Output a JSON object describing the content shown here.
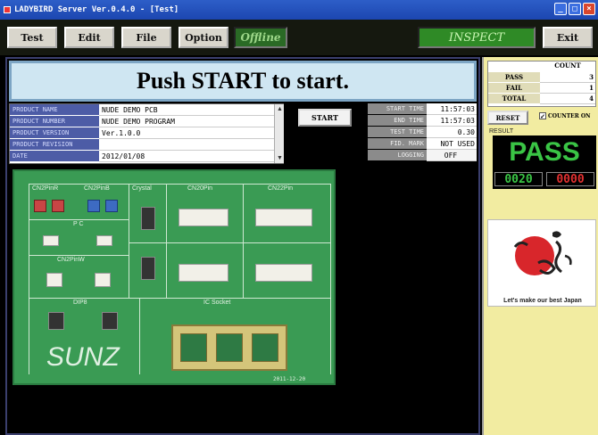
{
  "window": {
    "title": "LADYBIRD Server Ver.0.4.0 - [Test]"
  },
  "toolbar": {
    "test_label": "Test",
    "edit_label": "Edit",
    "file_label": "File",
    "option_label": "Option",
    "status_offline": "Offline",
    "mode_label": "INSPECT",
    "exit_label": "Exit"
  },
  "banner": {
    "text": "Push START to start."
  },
  "product": {
    "rows": [
      {
        "label": "PRODUCT NAME",
        "value": "NUDE DEMO PCB"
      },
      {
        "label": "PRODUCT NUMBER",
        "value": "NUDE DEMO PROGRAM"
      },
      {
        "label": "PRODUCT VERSION",
        "value": "Ver.1.0.0"
      },
      {
        "label": "PRODUCT REVISION",
        "value": ""
      },
      {
        "label": "DATE",
        "value": "2012/01/08"
      }
    ]
  },
  "start_button": "START",
  "times": {
    "rows": [
      {
        "label": "START TIME",
        "value": "11:57:03"
      },
      {
        "label": "END TIME",
        "value": "11:57:03"
      },
      {
        "label": "TEST TIME",
        "value": "0.30"
      },
      {
        "label": "FID. MARK",
        "value": "NOT USED"
      },
      {
        "label": "LOGGING",
        "value": "OFF"
      }
    ]
  },
  "pcb": {
    "labels": [
      "CN2PinR",
      "CN2PinB",
      "Crystal",
      "CN20Pin",
      "CN22Pin",
      "P C",
      "CN2PinW",
      "DIP8",
      "IC Socket"
    ],
    "brand": "SUNZ",
    "date": "2011-12-20"
  },
  "counter": {
    "header": "COUNT",
    "rows": [
      {
        "label": "PASS",
        "value": "3"
      },
      {
        "label": "FAIL",
        "value": "1"
      },
      {
        "label": "TOTAL",
        "value": "4"
      }
    ],
    "reset_label": "RESET",
    "counter_on_label": "COUNTER ON"
  },
  "result": {
    "label": "RESULT",
    "status": "PASS",
    "pass_count": "0020",
    "fail_count": "0000"
  },
  "logo": {
    "tagline": "Let's make our best Japan"
  },
  "colors": {
    "pass_green": "#3ac445",
    "fail_red": "#e03030",
    "right_panel_bg": "#f2eca1",
    "banner_bg": "#cfe6f2"
  }
}
